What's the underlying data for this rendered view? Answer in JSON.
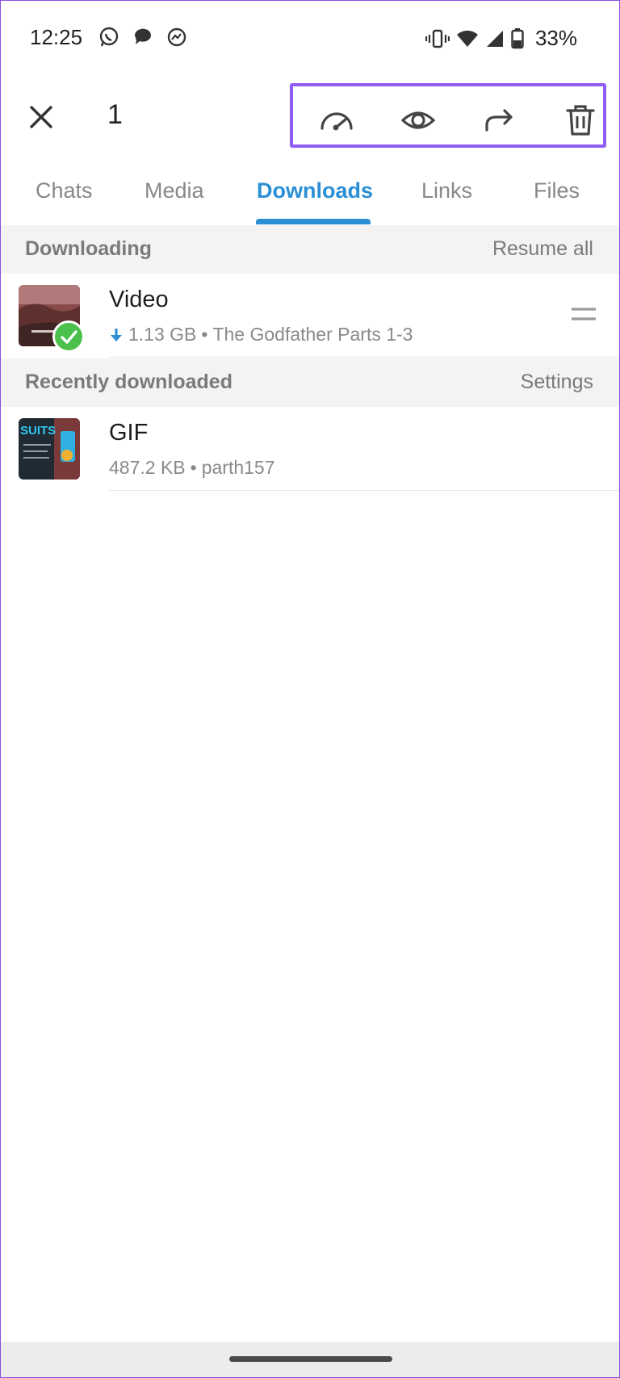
{
  "status_bar": {
    "time": "12:25",
    "battery": "33%"
  },
  "toolbar": {
    "selected_count": "1",
    "icons": [
      "speedometer-icon",
      "eye-icon",
      "forward-icon",
      "trash-icon"
    ]
  },
  "tabs": [
    {
      "label": "Chats",
      "active": false
    },
    {
      "label": "Media",
      "active": false
    },
    {
      "label": "Downloads",
      "active": true
    },
    {
      "label": "Links",
      "active": false
    },
    {
      "label": "Files",
      "active": false
    }
  ],
  "downloading": {
    "title": "Downloading",
    "action": "Resume all",
    "items": [
      {
        "title": "Video",
        "size": "1.13 GB",
        "source": "The Godfather Parts 1-3",
        "selected": true
      }
    ]
  },
  "recent": {
    "title": "Recently downloaded",
    "action": "Settings",
    "items": [
      {
        "title": "GIF",
        "size": "487.2 KB",
        "source": "parth157",
        "thumb_text": "SUITS"
      }
    ]
  },
  "separator": "•",
  "colors": {
    "accent": "#2b8fd6",
    "highlight_box": "#8f5cf6",
    "check": "#4cc04c"
  }
}
